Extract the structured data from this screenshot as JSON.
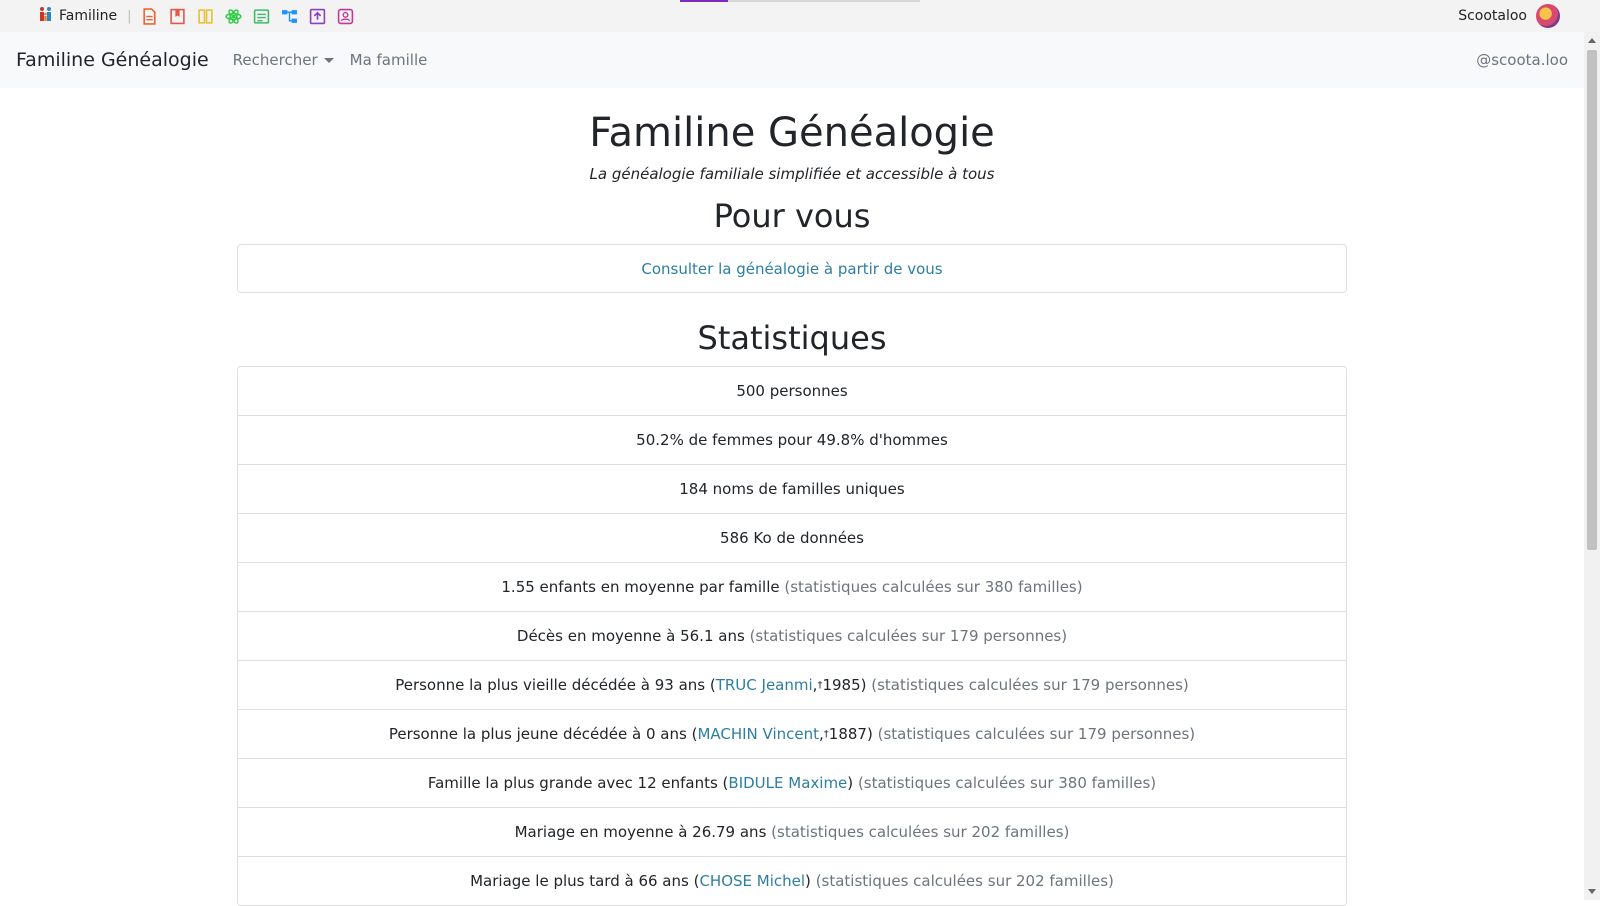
{
  "topbar": {
    "brand": "Familine",
    "separator": "|",
    "apps": [
      "document-icon",
      "bookmark-icon",
      "book-icon",
      "atom-icon",
      "notes-icon",
      "tree-icon",
      "upload-icon",
      "contact-icon"
    ],
    "user_name": "Scootaloo"
  },
  "navbar": {
    "brand": "Familine Généalogie",
    "items": [
      {
        "label": "Rechercher",
        "dropdown": true
      },
      {
        "label": "Ma famille",
        "dropdown": false
      }
    ],
    "handle": "@scoota.loo"
  },
  "main": {
    "title": "Familine Généalogie",
    "tagline": "La généalogie familiale simplifiée et accessible à tous",
    "pour_vous": {
      "heading": "Pour vous",
      "link": "Consulter la généalogie à partir de vous"
    },
    "stats": {
      "heading": "Statistiques",
      "s1": "500 personnes",
      "s2": "50.2% de femmes pour 49.8% d'hommes",
      "s3": "184 noms de familles uniques",
      "s4": "586 Ko de données",
      "s5": {
        "text": "1.55 enfants en moyenne par famille",
        "note": "(statistiques calculées sur 380 familles)"
      },
      "s6": {
        "text": "Décès en moyenne à 56.1 ans",
        "note": "(statistiques calculées sur 179 personnes)"
      },
      "s7": {
        "pre": "Personne la plus vieille décédée à 93 ans (",
        "link": "TRUC Jeanmi",
        "mid": ", ",
        "dagger": "†",
        "post": "1985)",
        "note": "(statistiques calculées sur 179 personnes)"
      },
      "s8": {
        "pre": "Personne la plus jeune décédée à 0 ans (",
        "link": "MACHIN Vincent",
        "mid": ", ",
        "dagger": "†",
        "post": "1887)",
        "note": "(statistiques calculées sur 179 personnes)"
      },
      "s9": {
        "pre": "Famille la plus grande avec 12 enfants (",
        "link": "BIDULE Maxime",
        "post": ")",
        "note": "(statistiques calculées sur 380 familles)"
      },
      "s10": {
        "text": "Mariage en moyenne à 26.79 ans",
        "note": "(statistiques calculées sur 202 familles)"
      },
      "s11": {
        "pre": "Mariage le plus tard à 66 ans (",
        "link": "CHOSE Michel",
        "post": ")",
        "note": "(statistiques calculées sur 202 familles)"
      }
    }
  },
  "colors": {
    "link": "#2c7fa0",
    "muted": "#6c757d",
    "accent": "#7b2cbf"
  }
}
